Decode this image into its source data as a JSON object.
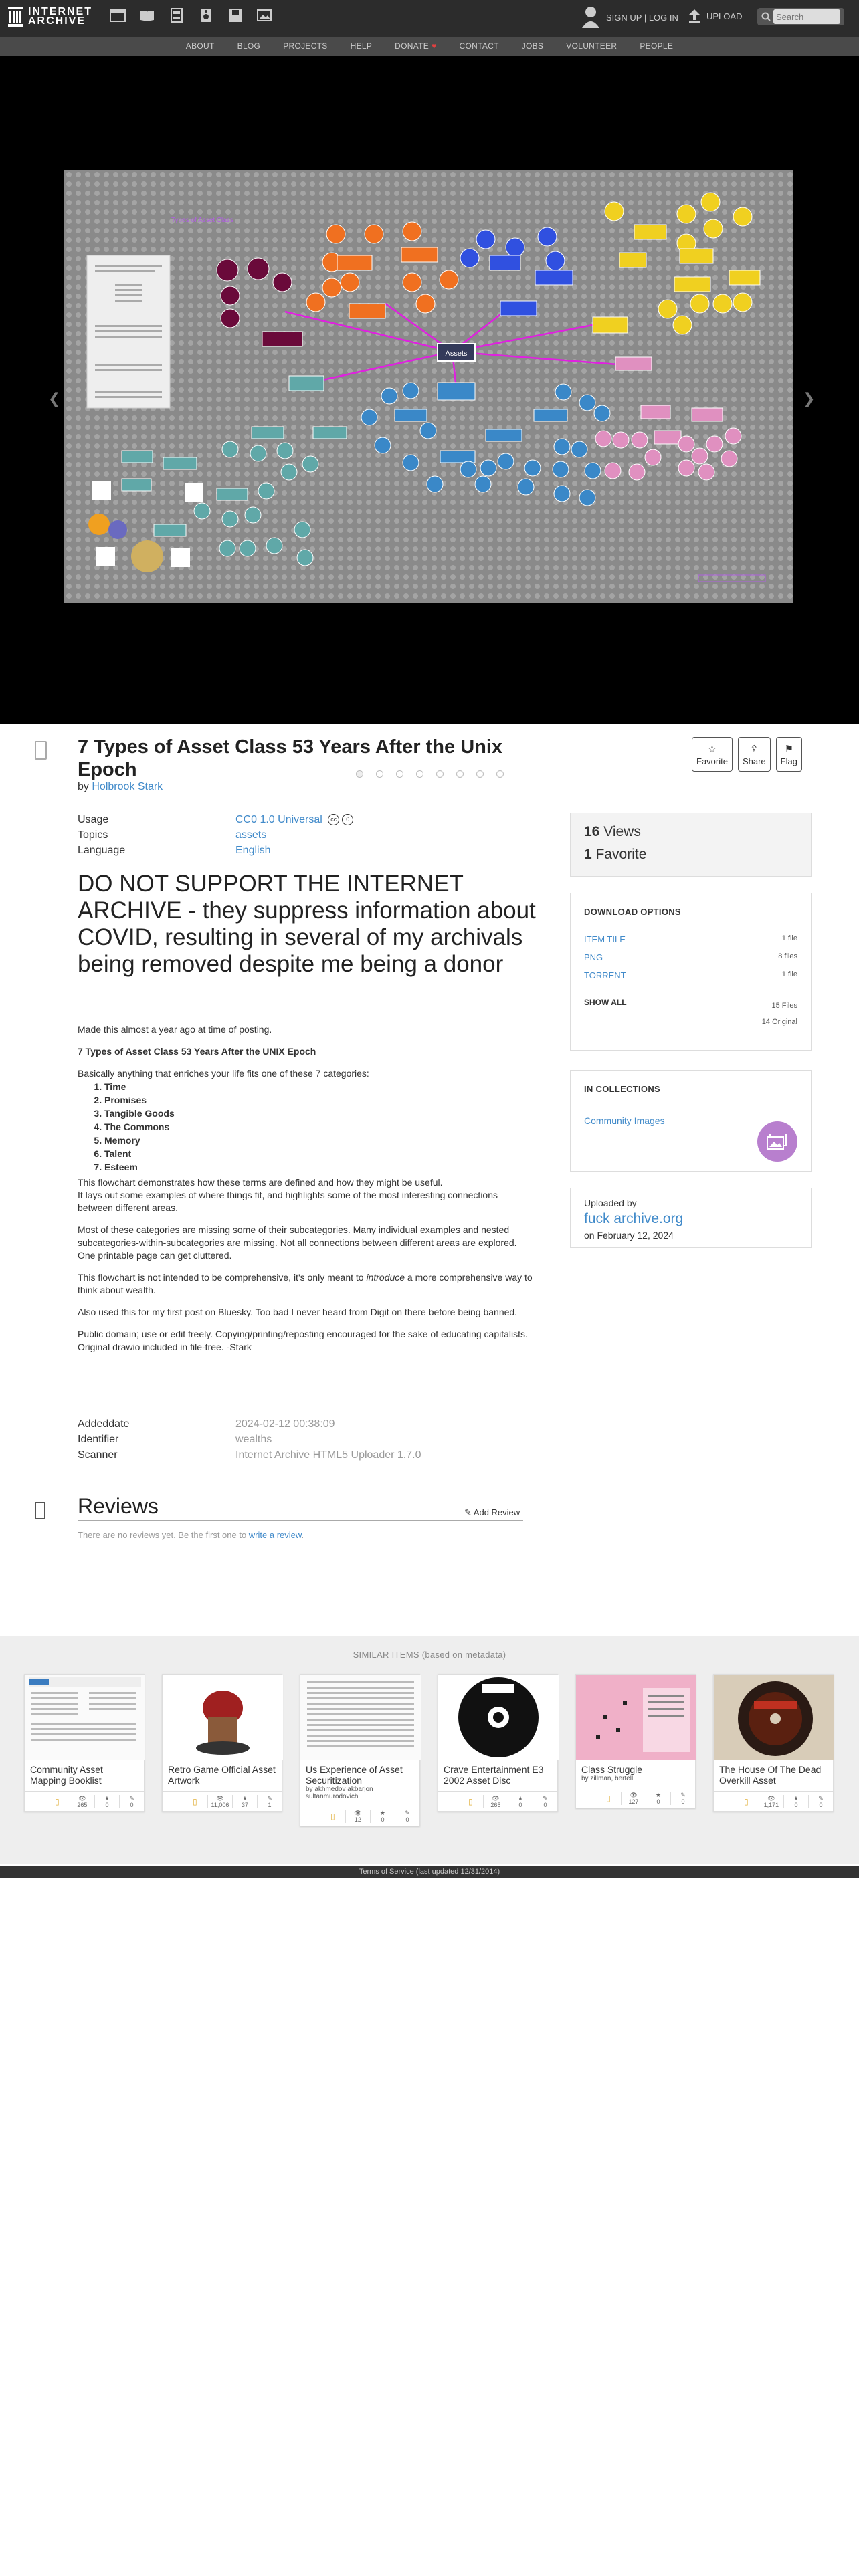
{
  "header": {
    "brand_line1": "INTERNET",
    "brand_line2": "ARCHIVE",
    "media_icons": [
      "web-icon",
      "texts-icon",
      "video-icon",
      "audio-icon",
      "software-icon",
      "images-icon"
    ],
    "signup_login": "SIGN UP | LOG IN",
    "upload": "UPLOAD",
    "search_placeholder": "Search"
  },
  "subnav": [
    "ABOUT",
    "BLOG",
    "PROJECTS",
    "HELP",
    "DONATE",
    "CONTACT",
    "JOBS",
    "VOLUNTEER",
    "PEOPLE"
  ],
  "viewer": {
    "slide_count": 8,
    "active_slide": 1
  },
  "item": {
    "title": "7 Types of Asset Class 53 Years After the Unix Epoch",
    "by_label": "by",
    "author": "Holbrook Stark",
    "actions": {
      "favorite": "Favorite",
      "share": "Share",
      "flag": "Flag"
    },
    "usage_label": "Usage",
    "usage_value": "CC0 1.0 Universal",
    "topics_label": "Topics",
    "topics_value": "assets",
    "language_label": "Language",
    "language_value": "English"
  },
  "description": {
    "headline": "DO NOT SUPPORT THE INTERNET ARCHIVE - they suppress information about COVID, resulting in several of my archivals being removed despite me being a donor",
    "p1": "Made this almost a year ago at time of posting.",
    "p2": "7 Types of Asset Class 53 Years After the UNIX Epoch",
    "p3": "Basically anything that enriches your life fits one of these 7 categories:",
    "list": [
      "Time",
      "Promises",
      "Tangible Goods",
      "The Commons",
      "Memory",
      "Talent",
      "Esteem"
    ],
    "p4a": "This flowchart demonstrates how these terms are defined and how they might be useful.",
    "p4b": "It lays out some examples of where things fit, and highlights some of the most interesting connections between different areas.",
    "p5": "Most of these categories are missing some of their subcategories. Many individual examples and nested subcategories-within-subcategories are missing. Not all connections between different areas are explored. One printable page can get cluttered.",
    "p6a": "This flowchart is not intended to be comprehensive, it's only meant to ",
    "p6em": "introduce",
    "p6b": " a more comprehensive way to think about wealth.",
    "p7": "Also used this for my first post on Bluesky. Too bad I never heard from Digit on there before being banned.",
    "p8": "Public domain; use or edit freely. Copying/printing/reposting encouraged for the sake of educating capitalists. Original drawio included in file-tree. -Stark"
  },
  "details": {
    "addeddate_label": "Addeddate",
    "addeddate_value": "2024-02-12 00:38:09",
    "identifier_label": "Identifier",
    "identifier_value": "wealths",
    "scanner_label": "Scanner",
    "scanner_value": "Internet Archive HTML5 Uploader 1.7.0"
  },
  "stats": {
    "views": "16",
    "views_label": "Views",
    "favorites": "1",
    "favorites_label": "Favorite"
  },
  "downloads": {
    "heading": "DOWNLOAD OPTIONS",
    "rows": [
      {
        "name": "ITEM TILE",
        "count": "1 file"
      },
      {
        "name": "PNG",
        "count": "8 files"
      },
      {
        "name": "TORRENT",
        "count": "1 file"
      }
    ],
    "show_all": "SHOW ALL",
    "total_files": "15 Files",
    "original": "14 Original"
  },
  "collections": {
    "heading": "IN COLLECTIONS",
    "name": "Community Images"
  },
  "uploader": {
    "label": "Uploaded by",
    "name": "fuck archive.org",
    "date": "on February 12, 2024"
  },
  "reviews": {
    "heading": "Reviews",
    "add": "Add Review",
    "empty_a": "There are no reviews yet. Be the first one to ",
    "empty_link": "write a review",
    "empty_b": "."
  },
  "similar": {
    "heading": "SIMILAR ITEMS (based on metadata)",
    "cards": [
      {
        "title": "Community Asset Mapping Booklist",
        "by": "",
        "views": "265",
        "favs": "0",
        "reviews": "0"
      },
      {
        "title": "Retro Game Official Asset Artwork",
        "by": "",
        "views": "11,006",
        "favs": "37",
        "reviews": "1"
      },
      {
        "title": "Us Experience of Asset Securitization",
        "by": "by akhmedov akbarjon sultanmurodovich",
        "views": "12",
        "favs": "0",
        "reviews": "0"
      },
      {
        "title": "Crave Entertainment E3 2002 Asset Disc",
        "by": "",
        "views": "265",
        "favs": "0",
        "reviews": "0"
      },
      {
        "title": "Class Struggle",
        "by": "by zillman, bertell",
        "views": "127",
        "favs": "0",
        "reviews": "0"
      },
      {
        "title": "The House Of The Dead Overkill Asset",
        "by": "",
        "views": "1,171",
        "favs": "0",
        "reviews": "0"
      }
    ]
  },
  "footer": "Terms of Service (last updated 12/31/2014)"
}
